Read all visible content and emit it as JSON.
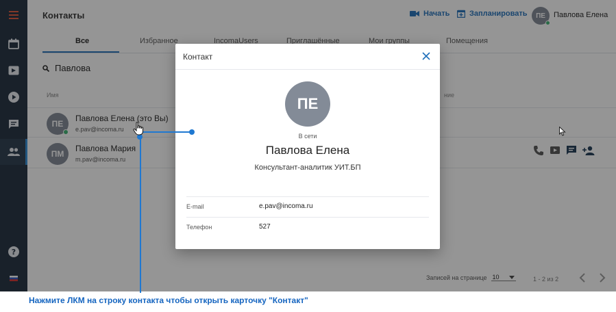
{
  "sidebar": {
    "items": [
      {
        "icon": "menu-icon"
      },
      {
        "icon": "calendar-icon"
      },
      {
        "icon": "video-icon"
      },
      {
        "icon": "play-icon"
      },
      {
        "icon": "chat-icon"
      },
      {
        "icon": "contacts-icon",
        "active": true
      },
      {
        "icon": "help-icon"
      },
      {
        "icon": "language-flag-icon"
      }
    ]
  },
  "header": {
    "title": "Контакты",
    "start_label": "Начать",
    "schedule_label": "Запланировать",
    "user_initials": "ПЕ",
    "user_name": "Павлова Елена"
  },
  "tabs": [
    "Все",
    "Избранное",
    "IncomaUsers",
    "Приглашённые",
    "Мои группы",
    "Помещения"
  ],
  "search": {
    "value": "Павлова"
  },
  "table": {
    "col_name": "Имя",
    "col_position": "ние",
    "rows": [
      {
        "initials": "ПЕ",
        "name": "Павлова Елена (это Вы)",
        "email": "e.pav@incoma.ru",
        "online": true
      },
      {
        "initials": "ПМ",
        "name": "Павлова Мария",
        "email": "m.pav@incoma.ru",
        "online": false
      }
    ]
  },
  "footer": {
    "per_page_label": "Записей на странице",
    "per_page_value": "10",
    "range": "1 - 2 из 2"
  },
  "modal": {
    "title": "Контакт",
    "initials": "ПЕ",
    "status": "В сети",
    "name": "Павлова Елена",
    "position": "Консультант-аналитик УИТ.БП",
    "fields": [
      {
        "label": "E-mail",
        "value": "e.pav@incoma.ru"
      },
      {
        "label": "Телефон",
        "value": "527"
      }
    ]
  },
  "instruction": "Нажмите ЛКМ на строку контакта чтобы открыть карточку \"Контакт\"",
  "colors": {
    "accent": "#1f6fba",
    "sidebar": "#1e2d3d",
    "online": "#3cb371",
    "callout": "#1f78d1"
  }
}
